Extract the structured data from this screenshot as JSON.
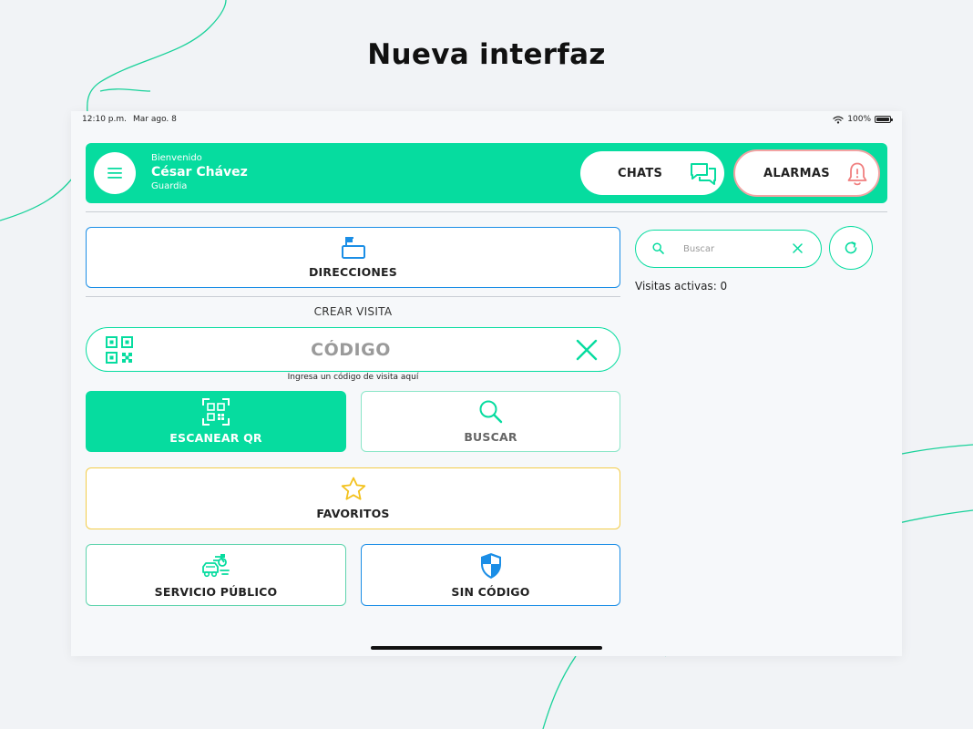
{
  "headline": "Nueva interfaz",
  "colors": {
    "primary": "#06dc9f",
    "blue": "#1b8ee6",
    "yellow": "#f3cd4a",
    "alarm": "#f07f7f",
    "background": "#f1f3f6"
  },
  "statusbar": {
    "time": "12:10 p.m.",
    "date": "Mar ago. 8",
    "battery": "100%",
    "icons": [
      "wifi-icon",
      "battery-icon"
    ]
  },
  "header": {
    "greeting": "Bienvenido",
    "user_name": "César Chávez",
    "role": "Guardia",
    "menu_icon": "hamburger-menu-icon",
    "chats_label": "CHATS",
    "chats_icon": "chat-bubbles-icon",
    "alarms_label": "ALARMAS",
    "alarms_icon": "bell-icon"
  },
  "main": {
    "direcciones_label": "DIRECCIONES",
    "direcciones_icon": "mailbox-icon",
    "section_title": "CREAR VISITA",
    "code_placeholder": "CÓDIGO",
    "code_icon": "qr-code-icon",
    "code_clear_icon": "close-icon",
    "code_hint": "Ingresa un código de visita aquí",
    "scan_label": "ESCANEAR QR",
    "scan_icon": "qr-scan-icon",
    "search_label": "BUSCAR",
    "search_icon": "search-icon",
    "favorites_label": "FAVORITOS",
    "favorites_icon": "star-icon",
    "public_service_label": "SERVICIO PÚBLICO",
    "public_service_icon": "vehicles-icon",
    "no_code_label": "SIN CÓDIGO",
    "no_code_icon": "shield-icon"
  },
  "side": {
    "search_placeholder": "Buscar",
    "search_value": "",
    "search_icon": "search-icon",
    "clear_icon": "close-icon",
    "refresh_icon": "refresh-icon",
    "active_visits": "Visitas activas: 0"
  }
}
